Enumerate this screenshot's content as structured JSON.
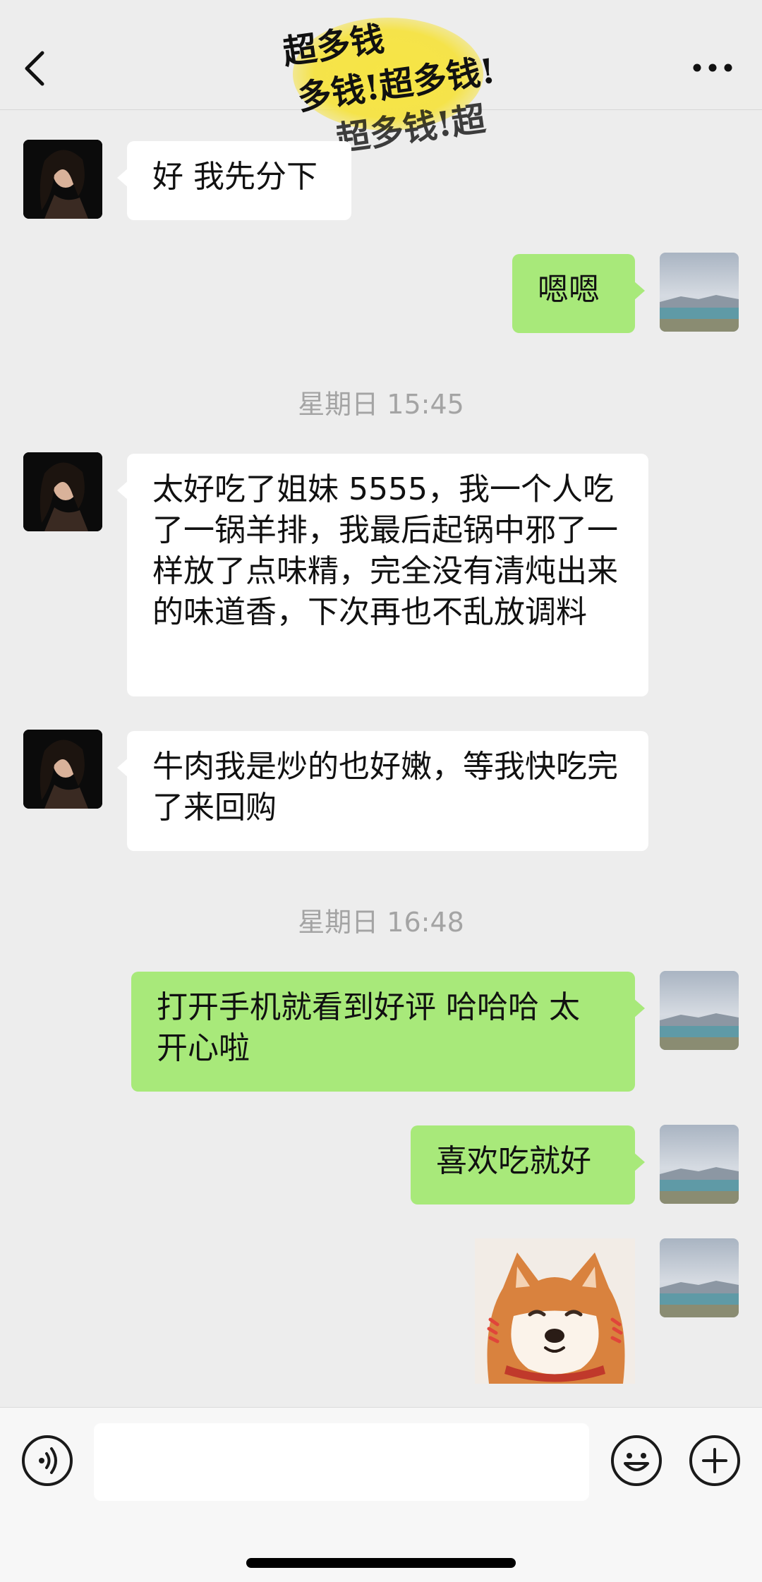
{
  "header": {
    "back_icon": "chevron-left-icon",
    "more_icon": "more-horizontal-icon",
    "title_sticker_lines": [
      "超多钱",
      "多钱!超多钱!",
      "超多钱!超"
    ]
  },
  "messages": [
    {
      "side": "in",
      "text": "好 我先分下"
    },
    {
      "side": "out",
      "text": "嗯嗯"
    },
    {
      "side": "in",
      "text": "太好吃了姐妹 5555，我一个人吃了一锅羊排，我最后起锅中邪了一样放了点味精，完全没有清炖出来的味道香，下次再也不乱放调料"
    },
    {
      "side": "in",
      "text": "牛肉我是炒的也好嫩，等我快吃完了来回购"
    },
    {
      "side": "out",
      "text": "打开手机就看到好评 哈哈哈 太开心啦"
    },
    {
      "side": "out",
      "text": "喜欢吃就好"
    },
    {
      "side": "out",
      "sticker": "shiba-dog-sticker"
    }
  ],
  "timestamps": [
    "星期日 15:45",
    "星期日 16:48"
  ],
  "input_bar": {
    "voice_icon": "voice-icon",
    "emoji_icon": "emoji-icon",
    "plus_icon": "plus-icon",
    "text_value": ""
  },
  "colors": {
    "background": "#ededed",
    "incoming_bubble": "#ffffff",
    "outgoing_bubble": "#a8e97a",
    "timestamp": "#a4a4a4"
  }
}
